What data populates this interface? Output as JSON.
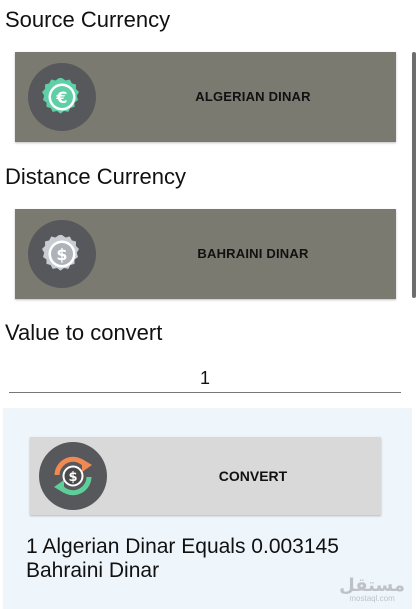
{
  "source": {
    "label": "Source Currency",
    "currency_name": "ALGERIAN DINAR",
    "icon": "euro-coin-icon",
    "icon_symbol": "€"
  },
  "target": {
    "label": "Distance Currency",
    "currency_name": "BAHRAINI DINAR",
    "icon": "dollar-coin-icon",
    "icon_symbol": "$"
  },
  "value": {
    "label": "Value to convert",
    "input_value": "1"
  },
  "convert": {
    "button_label": "CONVERT",
    "icon": "currency-exchange-icon",
    "icon_symbol": "$"
  },
  "result": {
    "text": "1 Algerian Dinar Equals 0.003145 Bahraini Dinar"
  },
  "watermark": {
    "main": "مستقل",
    "sub": "mostaql.com"
  },
  "colors": {
    "currency_button_bg": "#7b7a71",
    "convert_button_bg": "#d9d9d9",
    "icon_circle_bg": "#56585c",
    "euro_coin": "#5fcfa8",
    "dollar_coin": "#c9cdd3",
    "exchange_orange": "#f08a52",
    "exchange_green": "#5fcf9a",
    "panel_bg": "#eef5fb"
  }
}
